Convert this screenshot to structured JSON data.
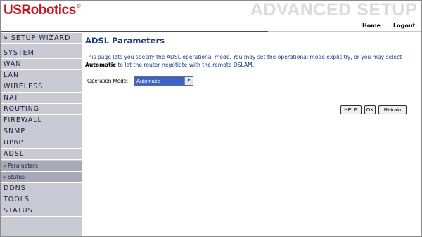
{
  "header": {
    "logo": "USRobotics",
    "logo_reg": "®",
    "section_title": "ADVANCED SETUP",
    "nav": {
      "home": "Home",
      "logout": "Logout"
    }
  },
  "sidebar": {
    "wizard": "» SETUP WIZARD",
    "items": [
      {
        "label": "SYSTEM"
      },
      {
        "label": "WAN"
      },
      {
        "label": "LAN"
      },
      {
        "label": "WIRELESS"
      },
      {
        "label": "NAT"
      },
      {
        "label": "ROUTING"
      },
      {
        "label": "FIREWALL"
      },
      {
        "label": "SNMP"
      },
      {
        "label": "UPnP"
      },
      {
        "label": "ADSL"
      },
      {
        "label": "» Parameters"
      },
      {
        "label": "» Status"
      },
      {
        "label": "DDNS"
      },
      {
        "label": "TOOLS"
      },
      {
        "label": "STATUS"
      }
    ]
  },
  "main": {
    "title": "ADSL Parameters",
    "desc_part1": "This page lets you specify the ADSL operational mode. You may set the operational mode explicitly, or you may select ",
    "desc_bold": "Automatic",
    "desc_part2": " to let the router negotiate with the remote DSLAM.",
    "operation_mode_label": "Operation Mode:",
    "operation_mode_value": "Automatic",
    "buttons": {
      "help": "HELP",
      "ok": "OK",
      "retrain": "Retrain"
    }
  },
  "colors": {
    "brand_red": "#d0121b",
    "sidebar_bg": "#c9cad4",
    "sidebar_sub_bg": "#a8a9b7",
    "title_blue": "#1f3b78",
    "select_blue": "#3b63c9"
  }
}
